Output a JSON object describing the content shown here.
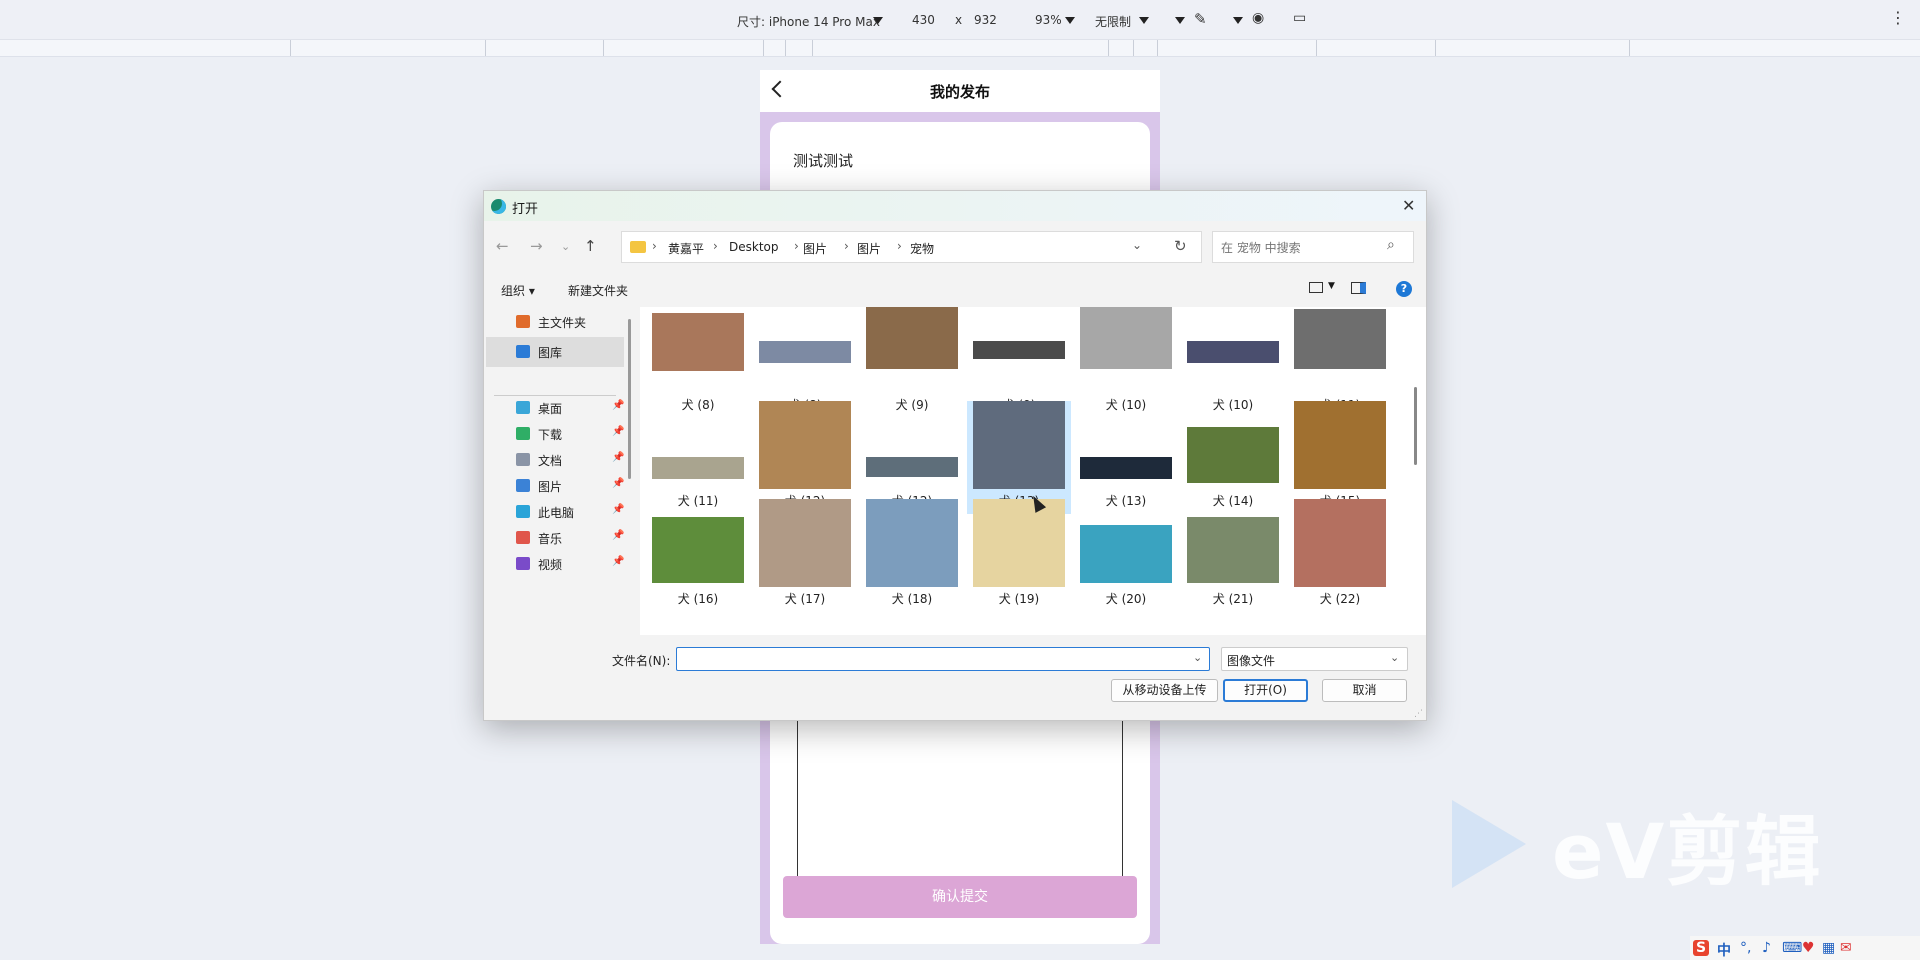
{
  "devtools": {
    "size_label": "尺寸: iPhone 14 Pro Max",
    "width": "430",
    "times": "x",
    "height": "932",
    "zoom": "93%",
    "throttle": "无限制",
    "more_icon": "more-vert-icon"
  },
  "phone": {
    "title": "我的发布",
    "post_title": "测试测试",
    "submit_label": "确认提交",
    "submit_color": "#dca6d6"
  },
  "dialog": {
    "title": "打开",
    "breadcrumbs": [
      "黄嘉平",
      "Desktop",
      "图片",
      "图片",
      "宠物"
    ],
    "search_placeholder": "在 宠物 中搜索",
    "toolbar": {
      "organize": "组织 ▾",
      "new_folder": "新建文件夹"
    },
    "nav": {
      "items": [
        {
          "label": "主文件夹",
          "icon": "home-icon",
          "color": "#e06b2b"
        },
        {
          "label": "图库",
          "icon": "gallery-icon",
          "color": "#2b7bd6",
          "selected": true
        },
        {
          "label": "桌面",
          "icon": "desktop-icon",
          "color": "#3aa6d8",
          "pinned": true
        },
        {
          "label": "下载",
          "icon": "download-icon",
          "color": "#2fae66",
          "pinned": true
        },
        {
          "label": "文档",
          "icon": "document-icon",
          "color": "#8a94a6",
          "pinned": true
        },
        {
          "label": "图片",
          "icon": "pictures-icon",
          "color": "#3b82d6",
          "pinned": true
        },
        {
          "label": "此电脑",
          "icon": "computer-icon",
          "color": "#2aa4d8",
          "pinned": true
        },
        {
          "label": "音乐",
          "icon": "music-icon",
          "color": "#e0564b",
          "pinned": true
        },
        {
          "label": "视频",
          "icon": "video-icon",
          "color": "#7a4bc9",
          "pinned": true
        }
      ]
    },
    "files": [
      {
        "label": "犬 (8)",
        "color": "#a9775b"
      },
      {
        "label": "犬 (8)",
        "color": "#7d8aa3"
      },
      {
        "label": "犬 (9)",
        "color": "#8a6a4a"
      },
      {
        "label": "犬 (9)",
        "color": "#4b4b4b"
      },
      {
        "label": "犬 (10)",
        "color": "#a7a7a7"
      },
      {
        "label": "犬 (10)",
        "color": "#4a4e6e"
      },
      {
        "label": "犬 (11)",
        "color": "#6e6e6e"
      },
      {
        "label": "犬 (11)",
        "color": "#a9a48f"
      },
      {
        "label": "犬 (12)",
        "color": "#b08655"
      },
      {
        "label": "犬 (12)",
        "color": "#5e6e7a"
      },
      {
        "label": "犬 (13)",
        "color": "#5f6b7d",
        "selected": true
      },
      {
        "label": "犬 (13)",
        "color": "#1e2a3a"
      },
      {
        "label": "犬 (14)",
        "color": "#5e7a3a"
      },
      {
        "label": "犬 (15)",
        "color": "#a07030"
      },
      {
        "label": "犬 (16)",
        "color": "#5e8d3b"
      },
      {
        "label": "犬 (17)",
        "color": "#b09a86"
      },
      {
        "label": "犬 (18)",
        "color": "#7c9dbd"
      },
      {
        "label": "犬 (19)",
        "color": "#e6d4a0"
      },
      {
        "label": "犬 (20)",
        "color": "#3aa3c0"
      },
      {
        "label": "犬 (21)",
        "color": "#7a8a6a"
      },
      {
        "label": "犬 (22)",
        "color": "#b47060"
      }
    ],
    "filename_label": "文件名(N):",
    "filename_value": "",
    "filetype": "图像文件",
    "btn_mobile": "从移动设备上传",
    "btn_open": "打开(O)",
    "btn_cancel": "取消"
  },
  "watermark": "eV剪辑",
  "tray": {
    "ime": "中"
  }
}
